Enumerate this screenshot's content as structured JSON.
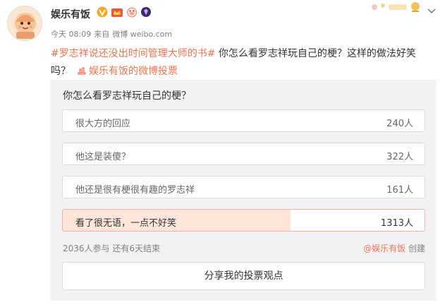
{
  "post": {
    "author": "娱乐有饭",
    "time": "今天 08:09",
    "from_label": "来自",
    "source": "微博 weibo.com",
    "hashtag": "#罗志祥说还没出时间管理大师的书#",
    "text": " 你怎么看罗志祥玩自己的梗？这样的做法好笑吗？",
    "vote_link": "娱乐有饭的微博投票"
  },
  "poll": {
    "question": "你怎么看罗志祥玩自己的梗？",
    "options": [
      {
        "label": "很大方的回应",
        "count": "240人",
        "votes": 240,
        "selected": false
      },
      {
        "label": "他这是装傻？",
        "count": "322人",
        "votes": 322,
        "selected": false
      },
      {
        "label": "他还是很有梗很有趣的罗志祥",
        "count": "161人",
        "votes": 161,
        "selected": false
      },
      {
        "label": "看了很无语，一点不好笑",
        "count": "1313人",
        "votes": 1313,
        "selected": true
      }
    ],
    "stats": "2036人参与  还有6天结束",
    "creator_link": "@娱乐有饭",
    "creator_suffix": "创建",
    "share_label": "分享我的投票观点"
  },
  "colors": {
    "accent": "#eb7350",
    "selected_fill": "#fde5d9",
    "unselected_fill": "#ffffff",
    "card_bg": "#f2f2f5"
  },
  "icons": {
    "verified": "verified-v-icon",
    "member": "member-crown-icon",
    "pig": "pig-badge-icon",
    "gem": "purple-gem-icon",
    "vote": "vote-lamp-icon",
    "menu": "chevron-down-icon"
  }
}
